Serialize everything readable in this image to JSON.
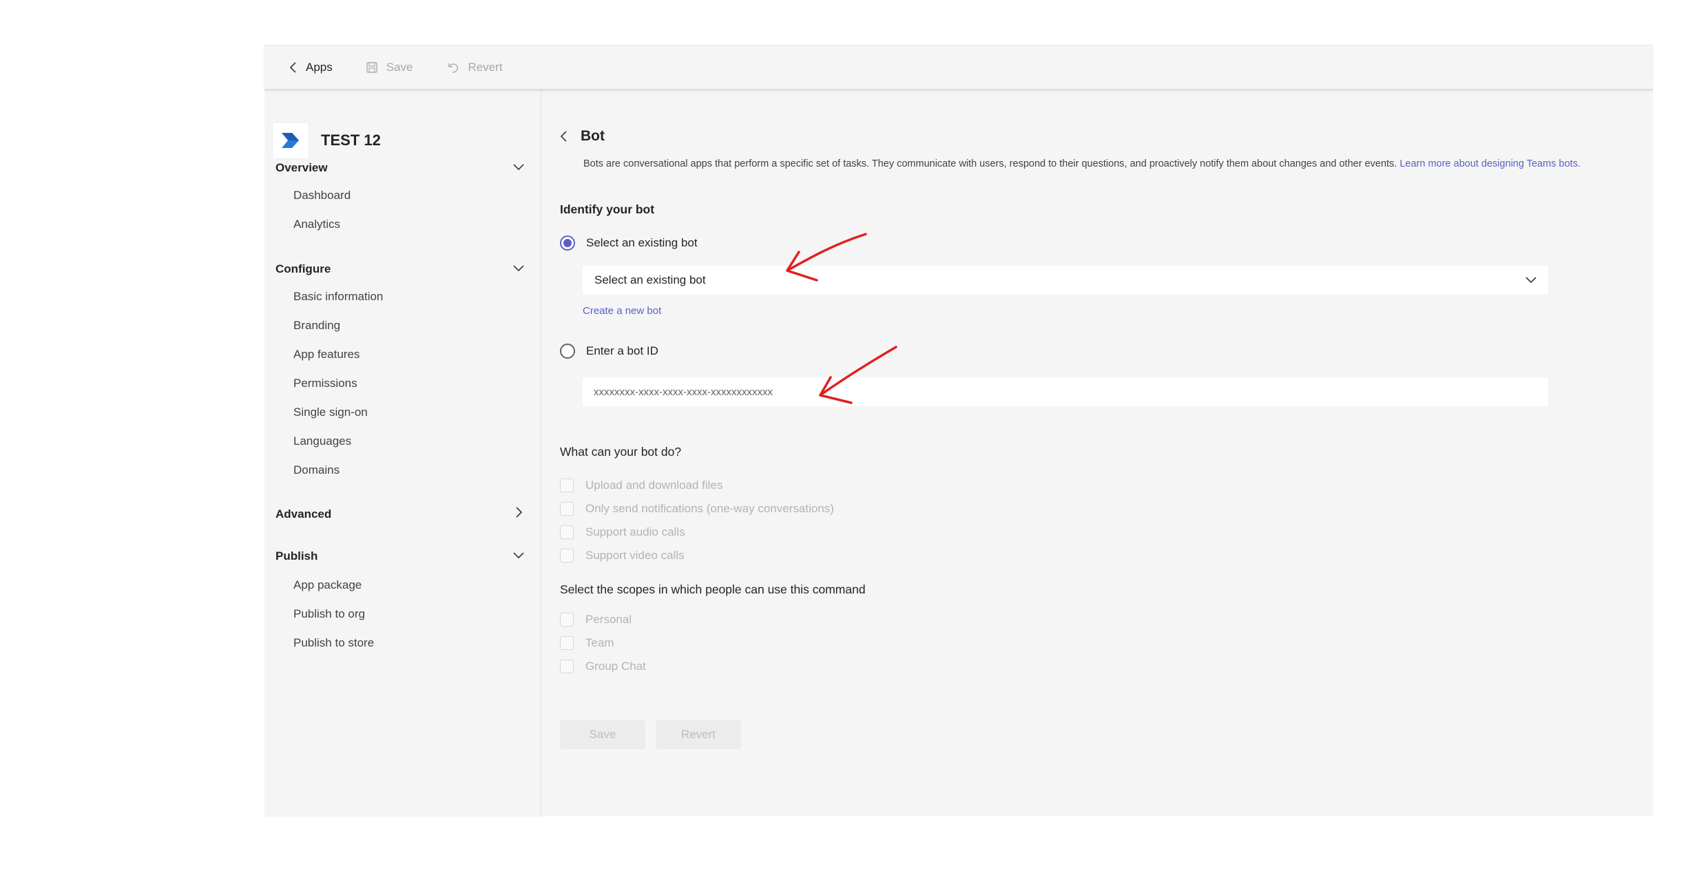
{
  "toolbar": {
    "back_label": "Apps",
    "save_label": "Save",
    "revert_label": "Revert"
  },
  "app": {
    "name": "TEST 12"
  },
  "nav": {
    "overview": {
      "label": "Overview",
      "items": [
        "Dashboard",
        "Analytics"
      ]
    },
    "configure": {
      "label": "Configure",
      "items": [
        "Basic information",
        "Branding",
        "App features",
        "Permissions",
        "Single sign-on",
        "Languages",
        "Domains"
      ]
    },
    "advanced": {
      "label": "Advanced"
    },
    "publish": {
      "label": "Publish",
      "items": [
        "App package",
        "Publish to org",
        "Publish to store"
      ]
    }
  },
  "bot": {
    "title": "Bot",
    "description": "Bots are conversational apps that perform a specific set of tasks. They communicate with users, respond to their questions, and proactively notify them about changes and other events.",
    "learn_more": "Learn more about designing Teams bots.",
    "identify_label": "Identify your bot",
    "option_existing": "Select an existing bot",
    "dropdown_value": "Select an existing bot",
    "create_new": "Create a new bot",
    "option_id": "Enter a bot ID",
    "id_placeholder": "xxxxxxxx-xxxx-xxxx-xxxx-xxxxxxxxxxxx",
    "capabilities_label": "What can your bot do?",
    "capabilities": [
      "Upload and download files",
      "Only send notifications (one-way conversations)",
      "Support audio calls",
      "Support video calls"
    ],
    "scopes_label": "Select the scopes in which people can use this command",
    "scopes": [
      "Personal",
      "Team",
      "Group Chat"
    ],
    "save_label": "Save",
    "revert_label": "Revert"
  },
  "colors": {
    "accent": "#5b5fc7",
    "annotation": "#e02020",
    "background": "#f5f5f5"
  }
}
